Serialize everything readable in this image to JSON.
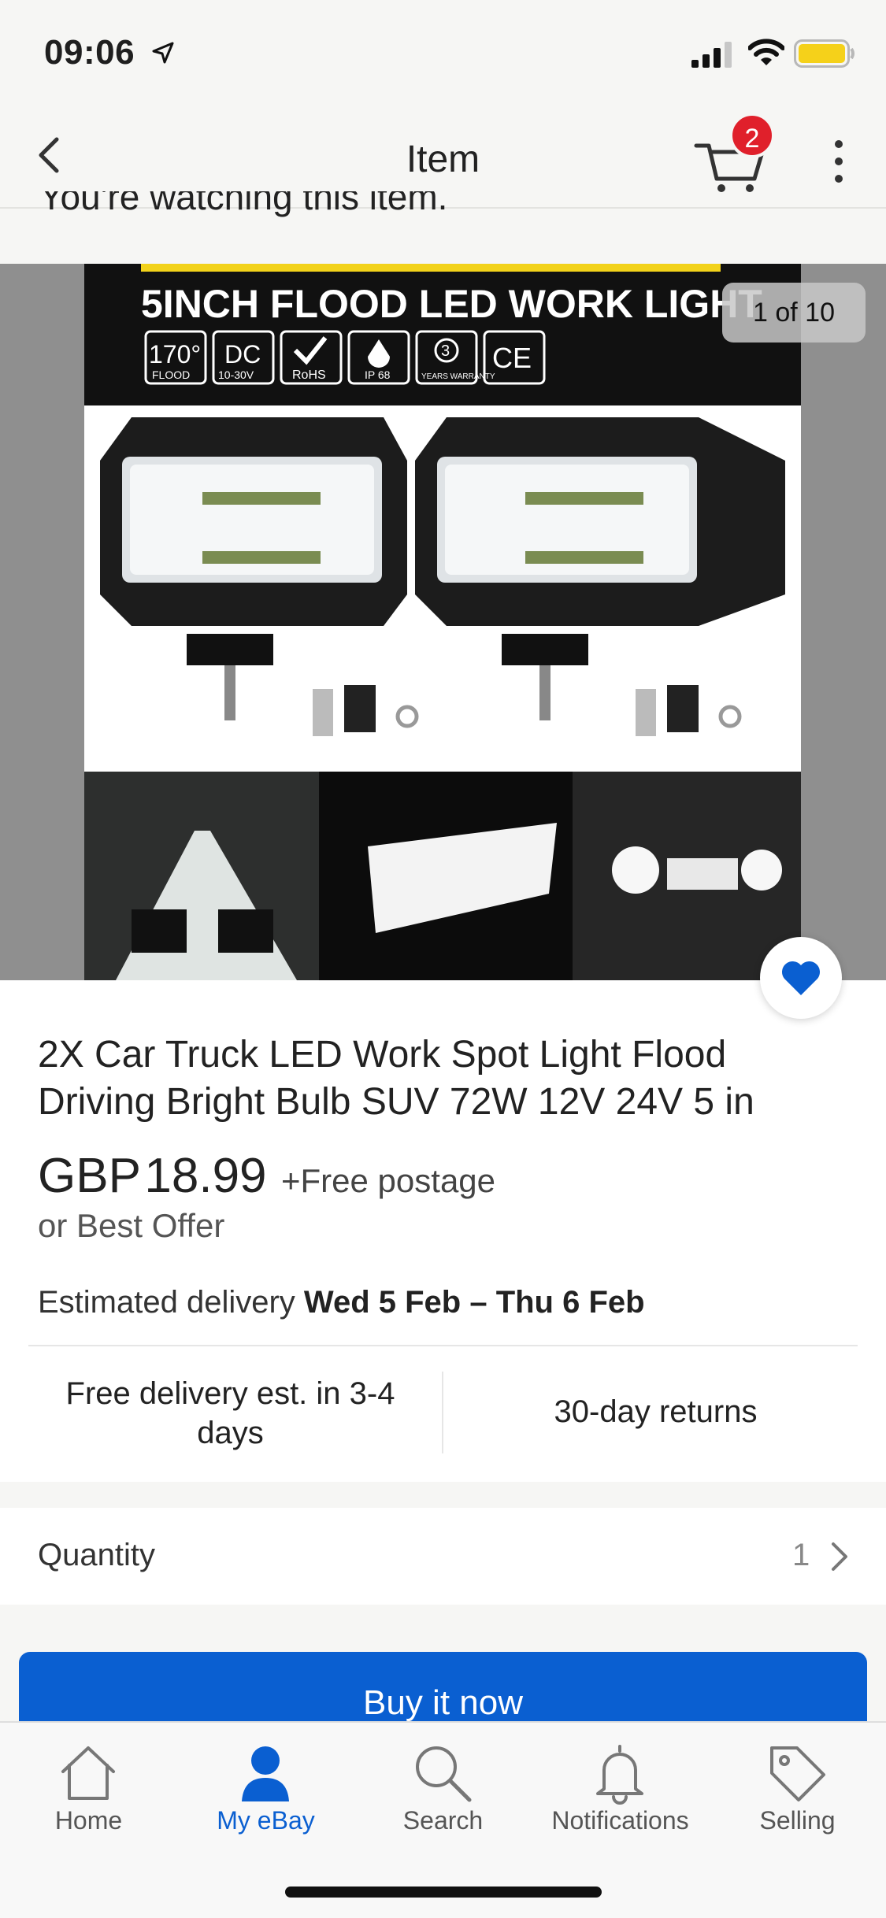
{
  "status_bar": {
    "time": "09:06"
  },
  "nav": {
    "title": "Item",
    "cart_count": "2"
  },
  "watching_notice": "You're watching this item.",
  "gallery": {
    "counter": "1 of 10",
    "image_headline": "5INCH FLOOD LED WORK LIGHT",
    "image_badges": [
      "170°",
      "DC",
      "RoHS",
      "IP 68",
      "3",
      "CE"
    ],
    "image_badge_subs": [
      "FLOOD",
      "10-30V",
      "",
      "",
      "YEARS WARRANTY",
      ""
    ]
  },
  "product": {
    "title": "2X Car Truck LED Work Spot Light Flood Driving Bright Bulb SUV 72W 12V 24V 5 in",
    "currency": "GBP",
    "price": "18.99",
    "postage": "+Free postage",
    "best_offer": "or Best Offer",
    "delivery_label": "Estimated delivery",
    "delivery_dates": "Wed 5 Feb – Thu 6 Feb",
    "feature_delivery": "Free delivery est. in 3-4 days",
    "feature_returns": "30-day returns"
  },
  "quantity": {
    "label": "Quantity",
    "value": "1"
  },
  "buy_button": "Buy it now",
  "tabs": [
    {
      "label": "Home",
      "icon": "home-icon"
    },
    {
      "label": "My eBay",
      "icon": "person-icon"
    },
    {
      "label": "Search",
      "icon": "search-icon"
    },
    {
      "label": "Notifications",
      "icon": "bell-icon"
    },
    {
      "label": "Selling",
      "icon": "tag-icon"
    }
  ],
  "colors": {
    "accent_blue": "#0a5fd1",
    "badge_red": "#e0202b",
    "battery_yellow": "#f5d11a"
  }
}
